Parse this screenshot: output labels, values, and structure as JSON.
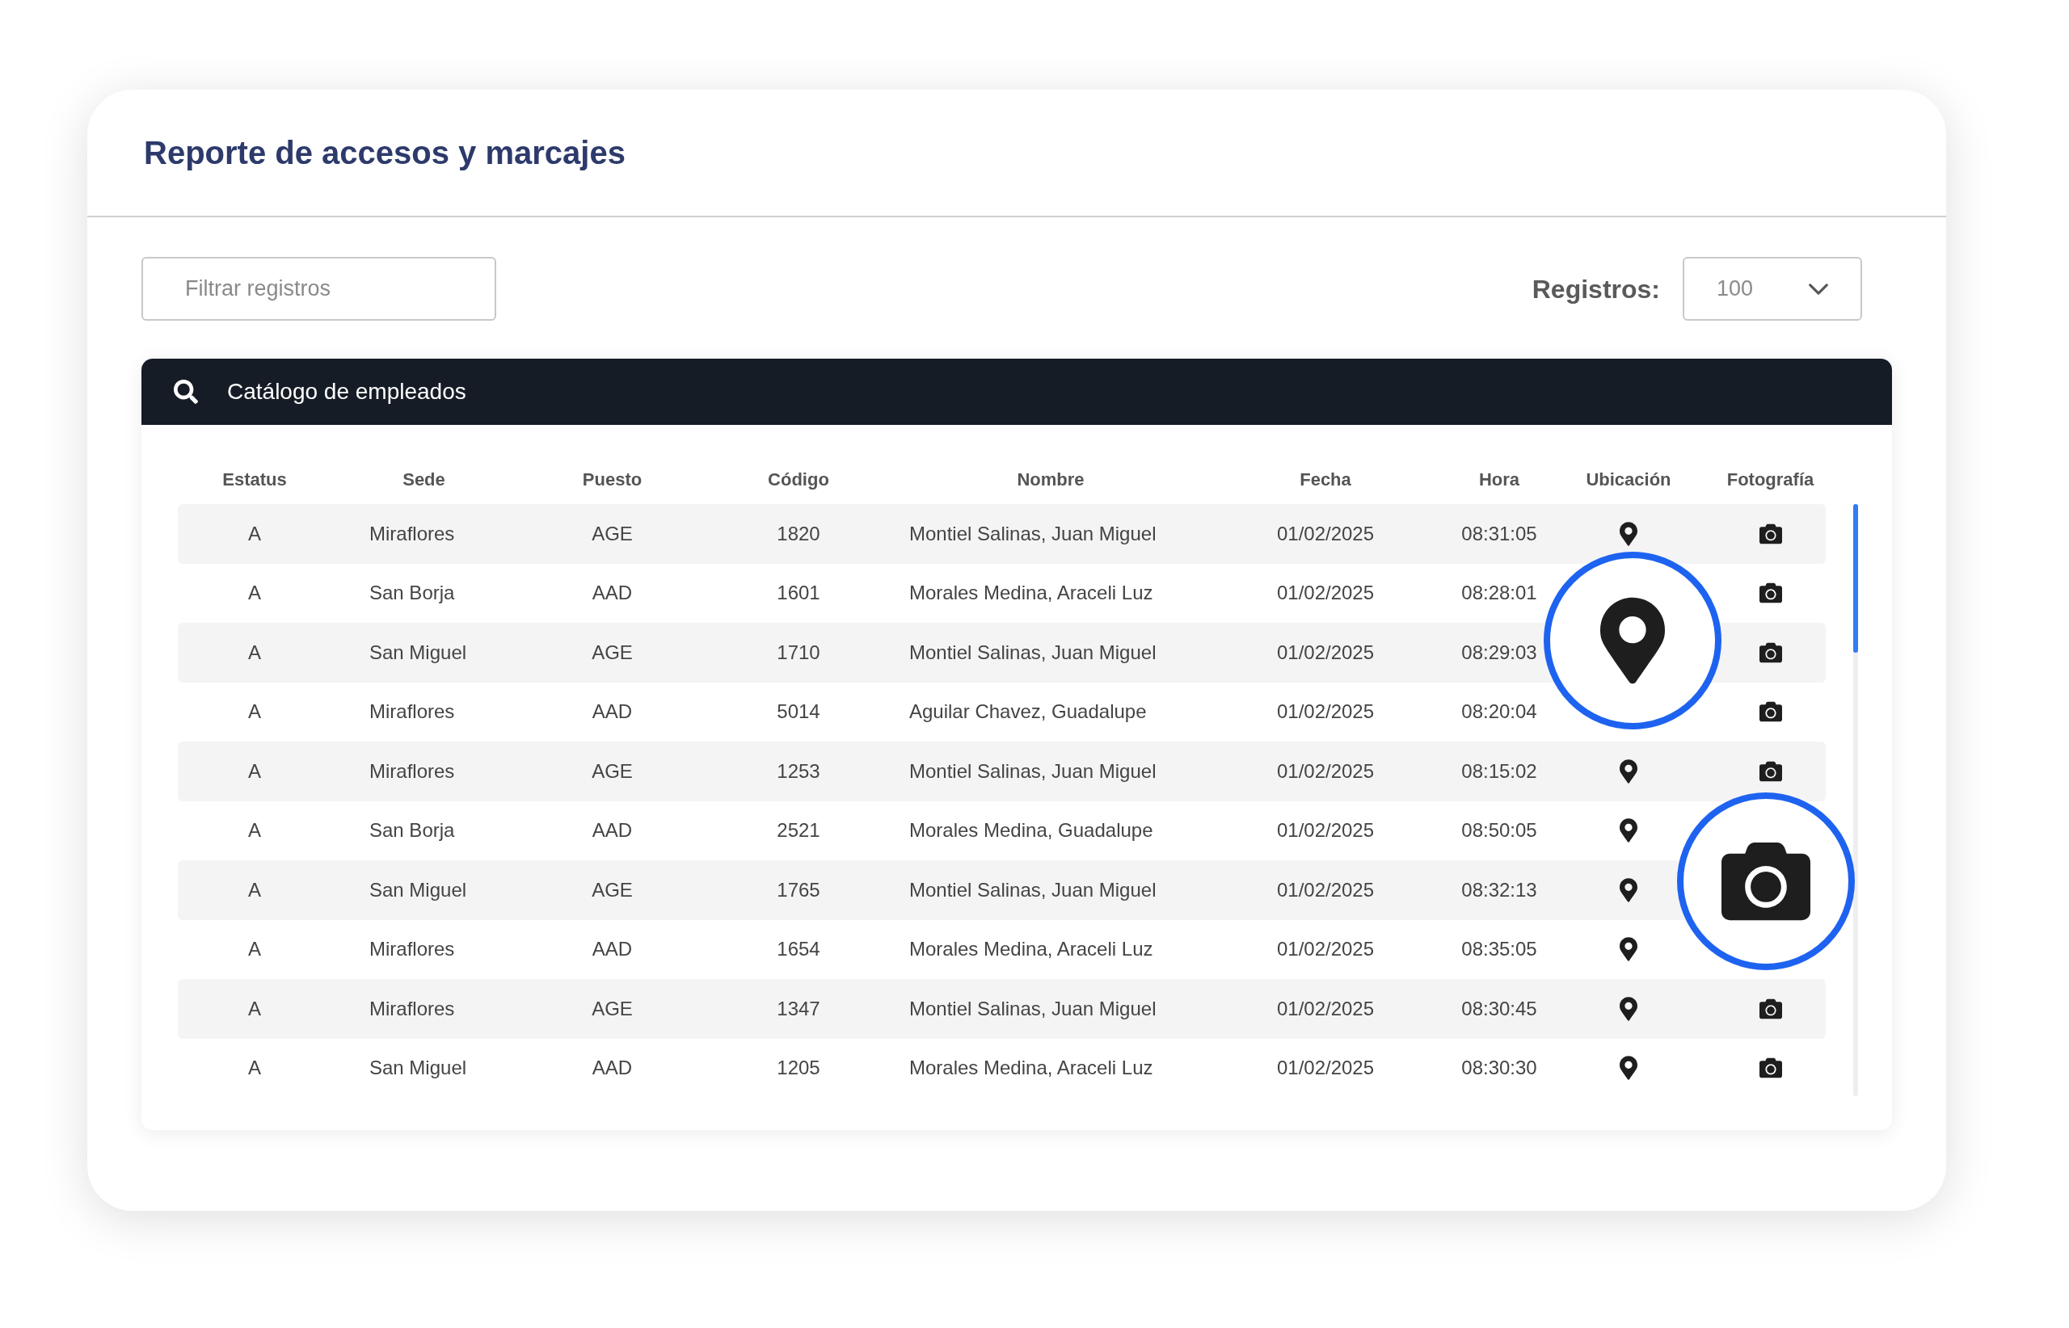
{
  "title": "Reporte de accesos y marcajes",
  "filter": {
    "placeholder": "Filtrar registros"
  },
  "records": {
    "label": "Registros:",
    "value": "100"
  },
  "catalog": {
    "label": "Catálogo de empleados"
  },
  "columns": [
    "Estatus",
    "Sede",
    "Puesto",
    "Código",
    "Nombre",
    "Fecha",
    "Hora",
    "Ubicación",
    "Fotografía"
  ],
  "rows": [
    {
      "estatus": "A",
      "sede": "Miraflores",
      "puesto": "AGE",
      "codigo": "1820",
      "nombre": "Montiel Salinas, Juan Miguel",
      "fecha": "01/02/2025",
      "hora": "08:31:05",
      "show_location": true,
      "show_photo": true
    },
    {
      "estatus": "A",
      "sede": "San Borja",
      "puesto": "AAD",
      "codigo": "1601",
      "nombre": "Morales Medina, Araceli Luz",
      "fecha": "01/02/2025",
      "hora": "08:28:01",
      "show_location": false,
      "show_photo": true
    },
    {
      "estatus": "A",
      "sede": "San Miguel",
      "puesto": "AGE",
      "codigo": "1710",
      "nombre": "Montiel Salinas, Juan Miguel",
      "fecha": "01/02/2025",
      "hora": "08:29:03",
      "show_location": false,
      "show_photo": true
    },
    {
      "estatus": "A",
      "sede": "Miraflores",
      "puesto": "AAD",
      "codigo": "5014",
      "nombre": "Aguilar Chavez, Guadalupe",
      "fecha": "01/02/2025",
      "hora": "08:20:04",
      "show_location": false,
      "show_photo": true
    },
    {
      "estatus": "A",
      "sede": "Miraflores",
      "puesto": "AGE",
      "codigo": "1253",
      "nombre": "Montiel Salinas, Juan Miguel",
      "fecha": "01/02/2025",
      "hora": "08:15:02",
      "show_location": true,
      "show_photo": true
    },
    {
      "estatus": "A",
      "sede": "San Borja",
      "puesto": "AAD",
      "codigo": "2521",
      "nombre": "Morales Medina, Guadalupe",
      "fecha": "01/02/2025",
      "hora": "08:50:05",
      "show_location": true,
      "show_photo": false
    },
    {
      "estatus": "A",
      "sede": "San Miguel",
      "puesto": "AGE",
      "codigo": "1765",
      "nombre": "Montiel Salinas, Juan Miguel",
      "fecha": "01/02/2025",
      "hora": "08:32:13",
      "show_location": true,
      "show_photo": false
    },
    {
      "estatus": "A",
      "sede": "Miraflores",
      "puesto": "AAD",
      "codigo": "1654",
      "nombre": "Morales Medina, Araceli Luz",
      "fecha": "01/02/2025",
      "hora": "08:35:05",
      "show_location": true,
      "show_photo": false
    },
    {
      "estatus": "A",
      "sede": "Miraflores",
      "puesto": "AGE",
      "codigo": "1347",
      "nombre": "Montiel Salinas, Juan Miguel",
      "fecha": "01/02/2025",
      "hora": "08:30:45",
      "show_location": true,
      "show_photo": true
    },
    {
      "estatus": "A",
      "sede": "San Miguel",
      "puesto": "AAD",
      "codigo": "1205",
      "nombre": "Morales Medina, Araceli Luz",
      "fecha": "01/02/2025",
      "hora": "08:30:30",
      "show_location": true,
      "show_photo": true
    }
  ]
}
